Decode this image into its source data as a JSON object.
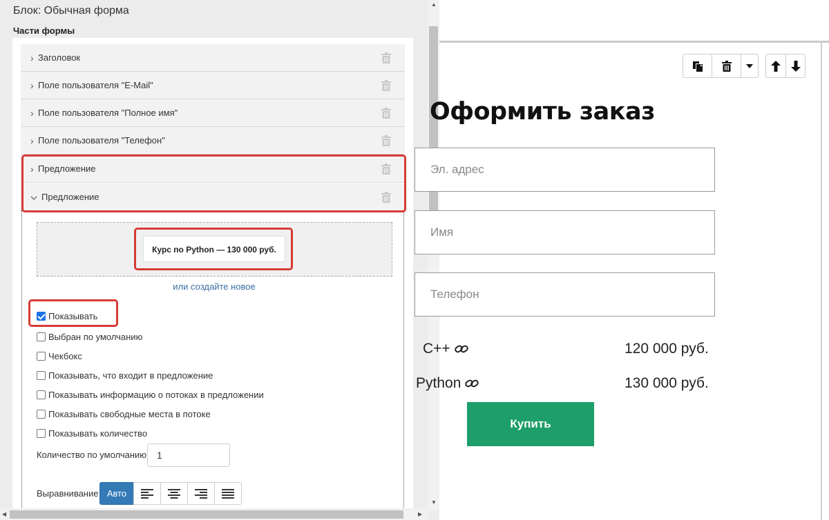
{
  "editor": {
    "block_title": "Блок: Обычная форма",
    "parts_label": "Части формы",
    "parts": [
      {
        "label": "Заголовок",
        "expanded": false
      },
      {
        "label": "Поле пользователя \"E-Mail\"",
        "expanded": false
      },
      {
        "label": "Поле пользователя \"Полное имя\"",
        "expanded": false
      },
      {
        "label": "Поле пользователя \"Телефон\"",
        "expanded": false
      },
      {
        "label": "Предложение",
        "expanded": false
      },
      {
        "label": "Предложение",
        "expanded": true
      }
    ],
    "offer": {
      "selected_offer": "Курс по Python — 130 000 руб.",
      "create_new_link": "или создайте новое",
      "options": [
        {
          "label": "Показывать",
          "checked": true
        },
        {
          "label": "Выбран по умолчанию",
          "checked": false
        },
        {
          "label": "Чекбокс",
          "checked": false
        },
        {
          "label": "Показывать, что входит в предложение",
          "checked": false
        },
        {
          "label": "Показывать информацию о потоках в предложении",
          "checked": false
        },
        {
          "label": "Показывать свободные места в потоке",
          "checked": false
        },
        {
          "label": "Показывать количество",
          "checked": false
        }
      ],
      "qty_label": "Количество по умолчанию",
      "qty_value": "1",
      "align_label": "Выравнивание",
      "align_auto": "Авто"
    }
  },
  "preview": {
    "title": "Оформить заказ",
    "fields": [
      "Эл. адрес",
      "Имя",
      "Телефон"
    ],
    "offers": [
      {
        "name": "C++",
        "price": "120 000 руб."
      },
      {
        "name": "Python",
        "price": "130 000 руб."
      }
    ],
    "buy_label": "Купить"
  }
}
